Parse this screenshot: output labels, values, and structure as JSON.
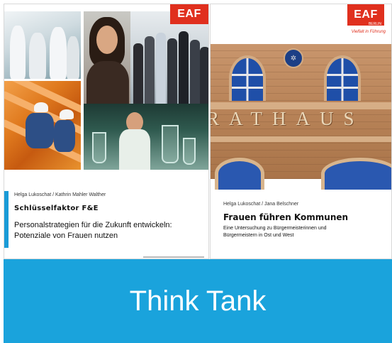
{
  "colors": {
    "brand_red": "#e0301e",
    "accent_blue": "#1aa3dc",
    "window_blue": "#1f4fa8"
  },
  "left_cover": {
    "logo": "EAF",
    "authors": "Helga Lukoschat / Kathrin Mahler Walther",
    "title": "Schlüsselfaktor F&E",
    "subtitle_line1": "Personalstrategien für die Zukunft entwickeln:",
    "subtitle_line2": "Potenziale von Frauen nutzen",
    "icons": [
      "photo-lab",
      "photo-woman",
      "photo-group",
      "photo-worker",
      "photo-scientist"
    ]
  },
  "right_cover": {
    "logo": "EAF",
    "logo_sub": "BERLIN",
    "tagline": "Vielfalt in Führung",
    "building_text": "RATHAUS",
    "authors": "Helga Lukoschat / Jana Belschner",
    "title": "Frauen führen Kommunen",
    "subtitle_line1": "Eine Untersuchung zu Bürgermeisterinnen und",
    "subtitle_line2": "Bürgermeistern in Ost und West"
  },
  "banner": {
    "label": "Think Tank"
  }
}
